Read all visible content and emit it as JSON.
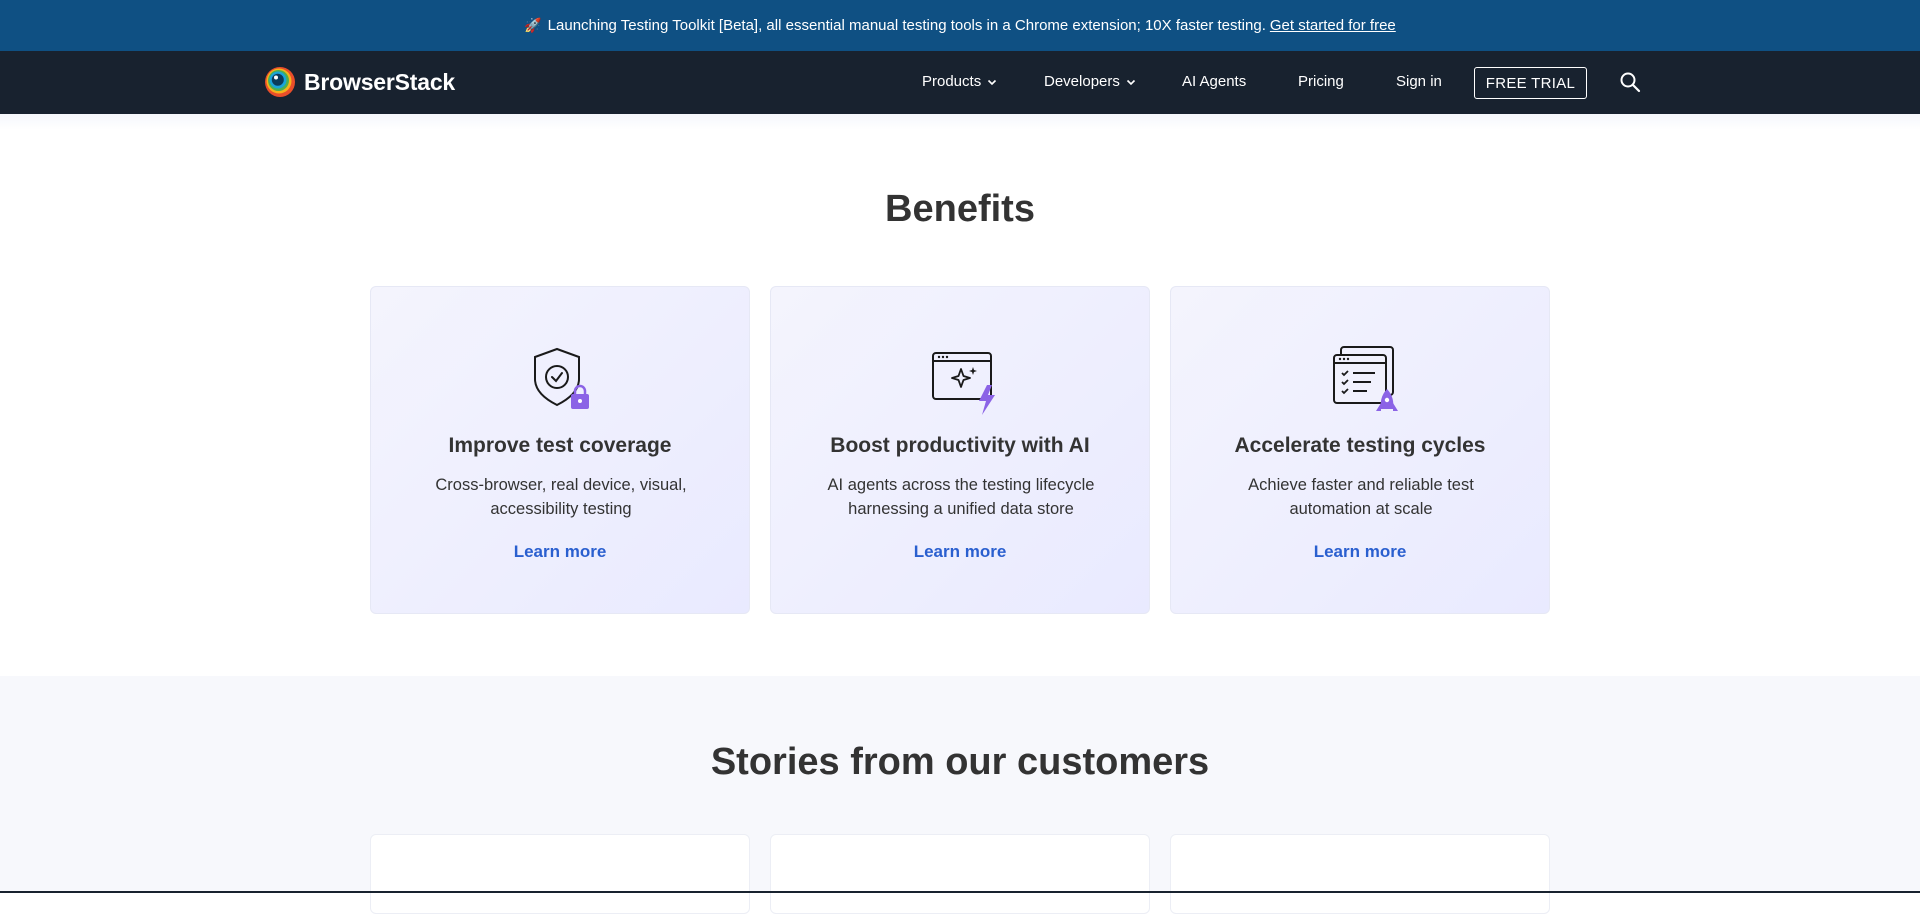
{
  "announcement": {
    "emoji": "🚀",
    "text": "Launching Testing Toolkit [Beta], all essential manual testing tools in a Chrome extension; 10X faster testing.",
    "link": "Get started for free"
  },
  "navbar": {
    "brand": "BrowserStack",
    "items": [
      {
        "label": "Products",
        "has_dropdown": true
      },
      {
        "label": "Developers",
        "has_dropdown": true
      },
      {
        "label": "AI Agents",
        "has_dropdown": false
      },
      {
        "label": "Pricing",
        "has_dropdown": false
      },
      {
        "label": "Sign in",
        "has_dropdown": false
      }
    ],
    "cta": "FREE TRIAL",
    "search_icon": "search-icon"
  },
  "benefits": {
    "title": "Benefits",
    "cards": [
      {
        "icon": "shield-check-lock-icon",
        "title": "Improve test coverage",
        "description": "Cross-browser, real device, visual, accessibility testing",
        "link": "Learn more"
      },
      {
        "icon": "ai-window-bolt-icon",
        "title": "Boost productivity with AI",
        "description": "AI agents across the testing lifecycle harnessing a unified data store",
        "link": "Learn more"
      },
      {
        "icon": "checklist-rocket-icon",
        "title": "Accelerate testing cycles",
        "description": "Achieve faster and reliable test automation at scale",
        "link": "Learn more"
      }
    ]
  },
  "stories": {
    "title": "Stories from our customers"
  },
  "colors": {
    "announcement_bg": "#0f5083",
    "navbar_bg": "#18222f",
    "link_blue": "#2a5fcf",
    "accent_purple": "#8b63e6"
  }
}
